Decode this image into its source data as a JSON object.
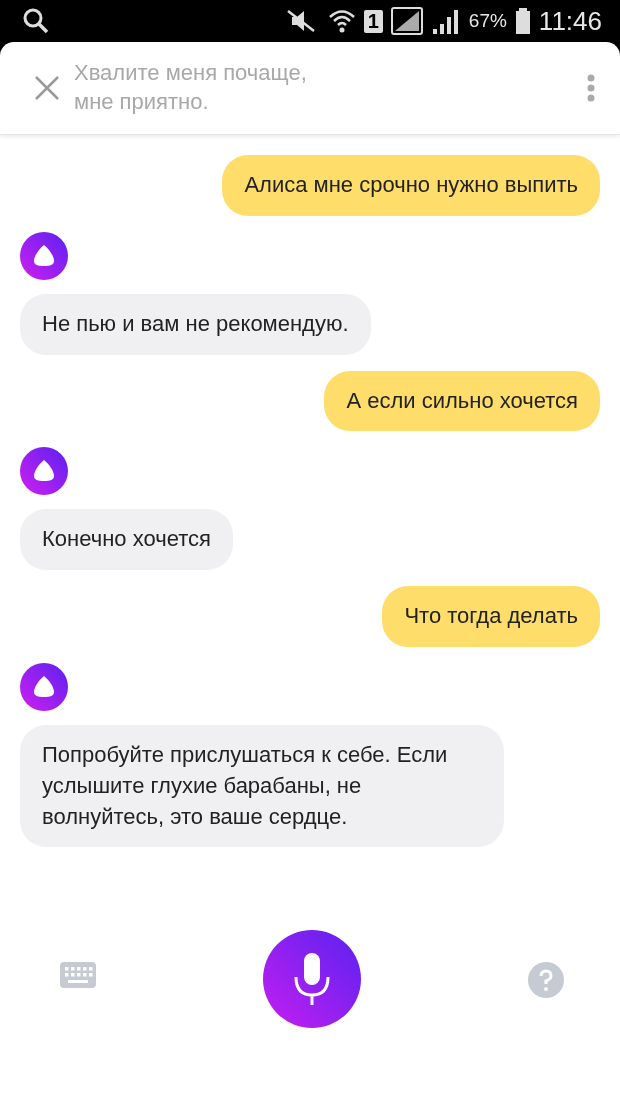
{
  "status_bar": {
    "sim": "1",
    "battery": "67%",
    "time": "11:46"
  },
  "header": {
    "faded_message": "Хвалите меня почаще, мне приятно."
  },
  "messages": [
    {
      "kind": "user",
      "text": "Алиса мне срочно нужно выпить"
    },
    {
      "kind": "bot",
      "text": "Не пью и вам не рекомендую."
    },
    {
      "kind": "user",
      "text": "А если сильно хочется"
    },
    {
      "kind": "bot",
      "text": "Конечно хочется"
    },
    {
      "kind": "user",
      "text": "Что тогда делать"
    },
    {
      "kind": "bot",
      "text": "Попробуйте прислушаться к себе. Если услышите глухие барабаны, не волнуйтесь, это ваше сердце."
    }
  ]
}
